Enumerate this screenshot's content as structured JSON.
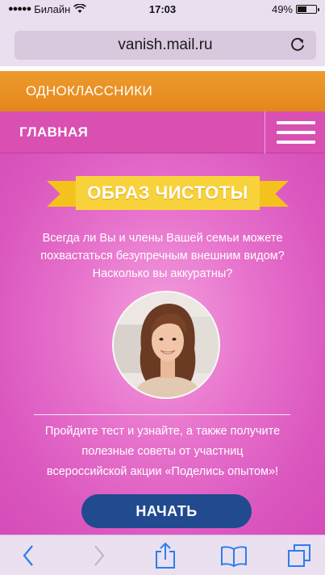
{
  "status_bar": {
    "carrier": "Билайн",
    "time": "17:03",
    "battery_percent_label": "49%",
    "battery_level": 0.49
  },
  "browser": {
    "url": "vanish.mail.ru"
  },
  "site_nav": {
    "brand_link": "ОДНОКЛАССНИКИ",
    "section_title": "ГЛАВНАЯ"
  },
  "content": {
    "banner_title": "ОБРАЗ ЧИСТОТЫ",
    "intro_line1": "Всегда ли Вы и члены Вашей семьи можете",
    "intro_line2": "похвастаться безупречным внешним видом?",
    "intro_line3": "Насколько вы аккуратны?",
    "cta_line1": "Пройдите тест и узнайте, а также получите",
    "cta_line2": "полезные советы от участниц",
    "cta_line3": "всероссийской акции «Поделись опытом»!",
    "start_button": "НАЧАТЬ"
  },
  "colors": {
    "orange_bar": "#e88f22",
    "pink_header": "#d94fb2",
    "banner_yellow": "#f8d23a",
    "button_blue": "#214a8f",
    "ios_blue": "#2a7ef0"
  },
  "toolbar": {
    "icons": [
      "back-icon",
      "forward-icon",
      "share-icon",
      "bookmarks-icon",
      "tabs-icon"
    ]
  }
}
